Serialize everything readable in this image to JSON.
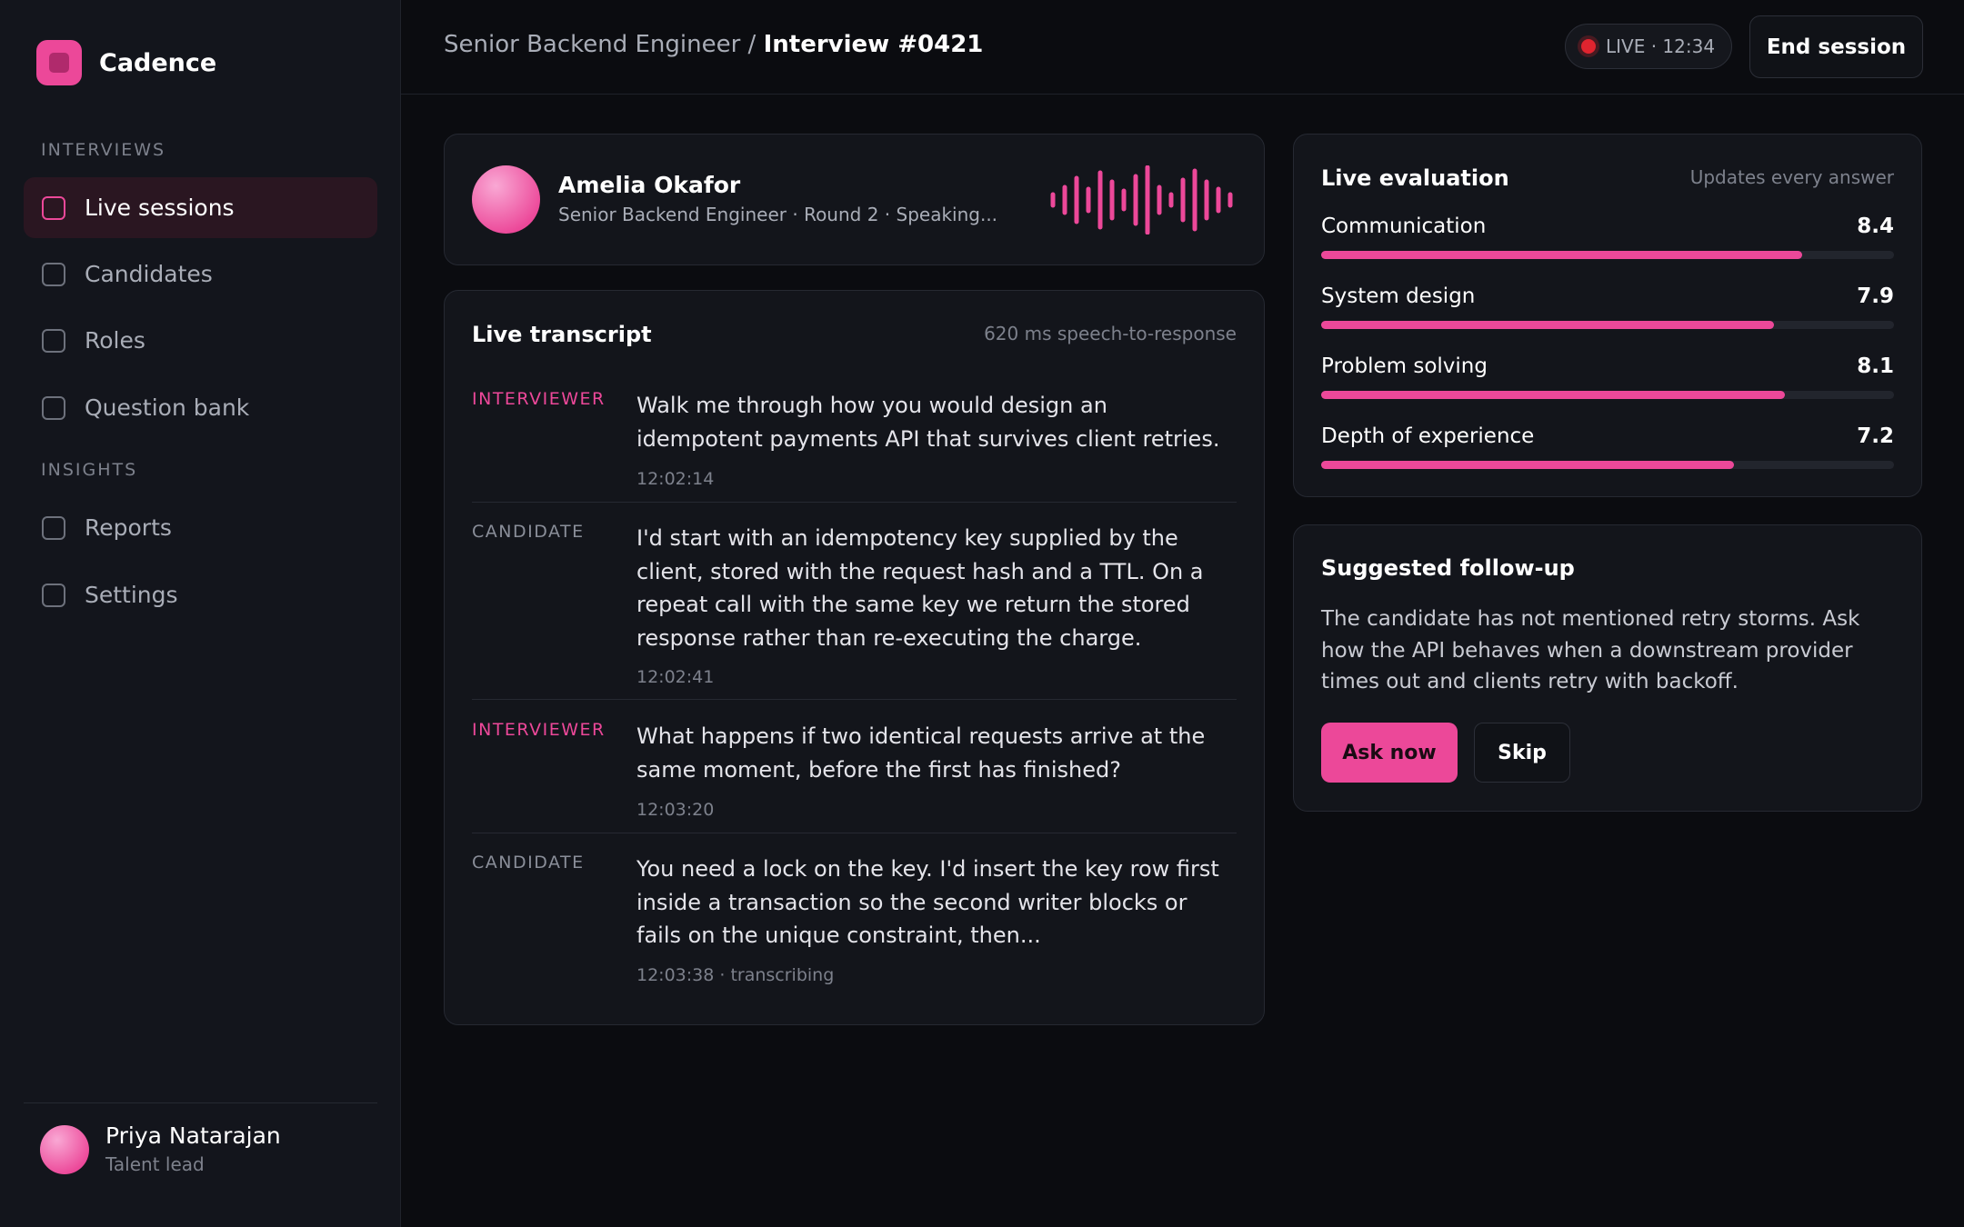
{
  "app": {
    "name": "Cadence"
  },
  "sidebar": {
    "sections": [
      "Interviews",
      "Insights"
    ],
    "items": [
      {
        "label": "Live sessions",
        "active": true
      },
      {
        "label": "Candidates"
      },
      {
        "label": "Roles"
      },
      {
        "label": "Question bank"
      },
      {
        "label": "Reports"
      },
      {
        "label": "Settings"
      }
    ],
    "user": {
      "name": "Priya Natarajan",
      "role": "Talent lead"
    }
  },
  "header": {
    "breadcrumb": {
      "parent": "Senior Backend Engineer",
      "separator": " / ",
      "current": "Interview #0421"
    },
    "live_status": "LIVE · 12:34",
    "end_label": "End session"
  },
  "candidate": {
    "name": "Amelia Okafor",
    "meta": "Senior Backend Engineer · Round 2 · Speaking..."
  },
  "transcript": {
    "title": "Live transcript",
    "latency": "620 ms speech-to-response",
    "entries": [
      {
        "speaker": "INTERVIEWER",
        "text": "Walk me through how you would design an idempotent payments API that survives client retries.",
        "time": "12:02:14"
      },
      {
        "speaker": "CANDIDATE",
        "text": "I'd start with an idempotency key supplied by the client, stored with the request hash and a TTL. On a repeat call with the same key we return the stored response rather than re-executing the charge.",
        "time": "12:02:41"
      },
      {
        "speaker": "INTERVIEWER",
        "text": "What happens if two identical requests arrive at the same moment, before the first has finished?",
        "time": "12:03:20"
      },
      {
        "speaker": "CANDIDATE",
        "text": "You need a lock on the key. I'd insert the key row first inside a transaction so the second writer blocks or fails on the unique constraint, then...",
        "time": "12:03:38 · transcribing"
      }
    ]
  },
  "evaluation": {
    "title": "Live evaluation",
    "note": "Updates every answer",
    "metrics": [
      {
        "label": "Communication",
        "value": "8.4",
        "score": 8.4
      },
      {
        "label": "System design",
        "value": "7.9",
        "score": 7.9
      },
      {
        "label": "Problem solving",
        "value": "8.1",
        "score": 8.1
      },
      {
        "label": "Depth of experience",
        "value": "7.2",
        "score": 7.2
      }
    ]
  },
  "followup": {
    "title": "Suggested follow-up",
    "text": "The candidate has not mentioned retry storms. Ask how the API behaves when a downstream provider times out and clients retry with backoff.",
    "ask_label": "Ask now",
    "skip_label": "Skip"
  },
  "colors": {
    "accent": "#ec4899",
    "live": "#e0242f",
    "background": "#0b0c10",
    "panel": "#13151b"
  },
  "icons": {
    "brand": "cadence-logo-icon",
    "nav": "checkbox-square-icon",
    "live": "recording-dot-icon",
    "audio": "audio-waveform-icon"
  }
}
